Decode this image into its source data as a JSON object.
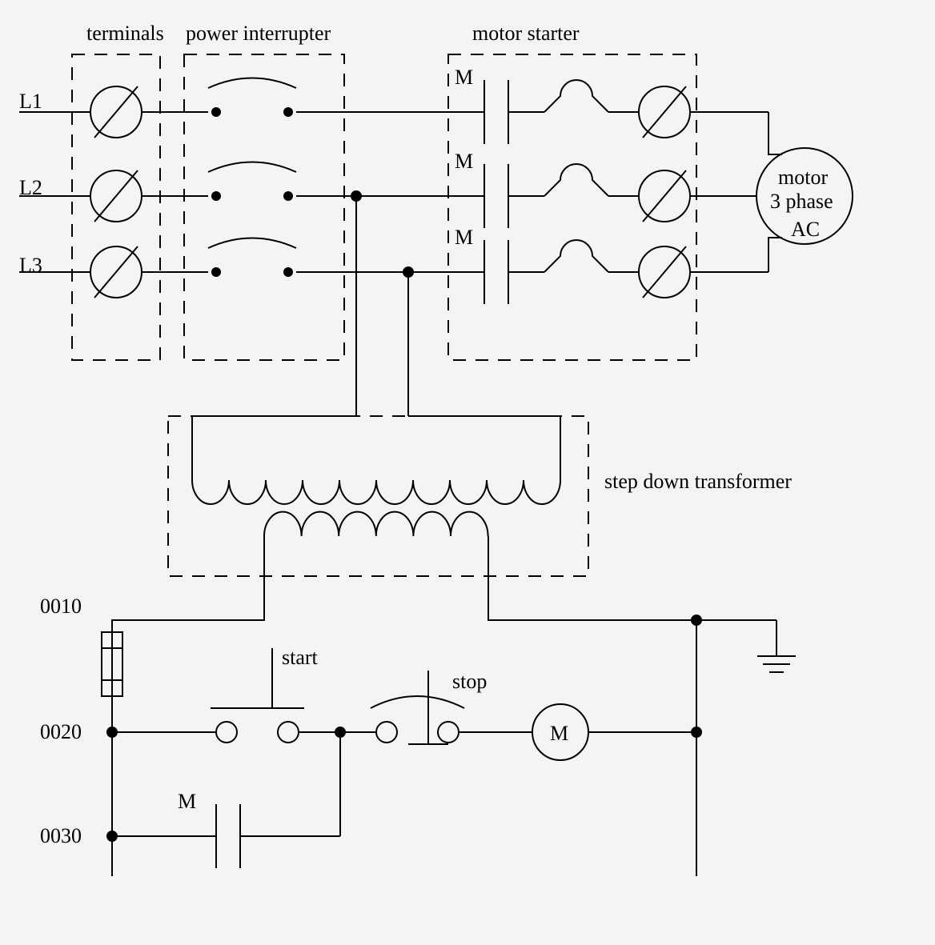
{
  "labels": {
    "terminals": "terminals",
    "powerInterrupter": "power interrupter",
    "motorStarter": "motor starter",
    "stepDownTransformer": "step down transformer",
    "L1": "L1",
    "L2": "L2",
    "L3": "L3",
    "M": "M",
    "motor": "motor",
    "threePhase": "3 phase",
    "AC": "AC",
    "start": "start",
    "stop": "stop",
    "rung0010": "0010",
    "rung0020": "0020",
    "rung0030": "0030"
  }
}
